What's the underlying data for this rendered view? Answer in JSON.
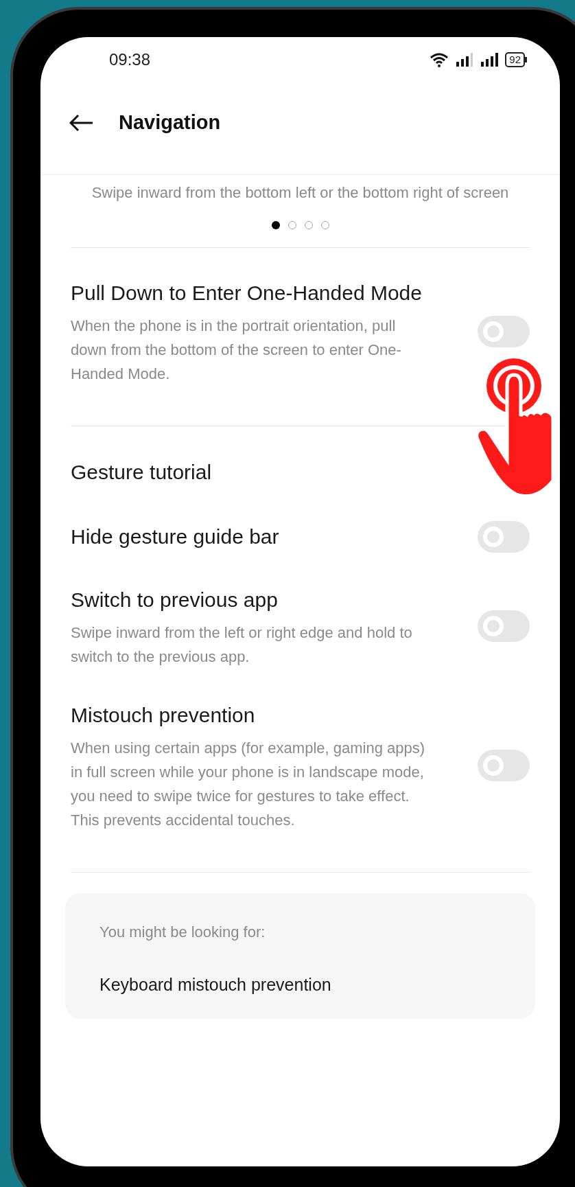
{
  "status_bar": {
    "time": "09:38",
    "battery": "92"
  },
  "header": {
    "title": "Navigation"
  },
  "gesture_preview": {
    "caption": "Swipe inward from the bottom left or the bottom right of screen",
    "page_dots": [
      {
        "selected": true
      },
      {
        "selected": false
      },
      {
        "selected": false
      },
      {
        "selected": false
      }
    ]
  },
  "sections": [
    {
      "settings": [
        {
          "kind": "toggle",
          "title": "Pull Down to Enter One-Handed Mode",
          "description": "When the phone is in the portrait orientation, pull down from the bottom of the screen to enter One-Handed Mode.",
          "on": false
        }
      ]
    },
    {
      "settings": [
        {
          "kind": "link",
          "title": "Gesture tutorial"
        },
        {
          "kind": "toggle",
          "title": "Hide gesture guide bar",
          "on": false
        },
        {
          "kind": "toggle",
          "title": "Switch to previous app",
          "description": "Swipe inward from the left or right edge and hold to switch to the previous app.",
          "on": false
        },
        {
          "kind": "toggle",
          "title": "Mistouch prevention",
          "description": "When using certain apps (for example, gaming apps) in full screen while your phone is in landscape mode, you need to swipe twice for gestures to take effect. This prevents accidental touches.",
          "on": false
        }
      ]
    }
  ],
  "suggestions": {
    "heading": "You might be looking for:",
    "items": [
      "Keyboard mistouch prevention"
    ]
  }
}
